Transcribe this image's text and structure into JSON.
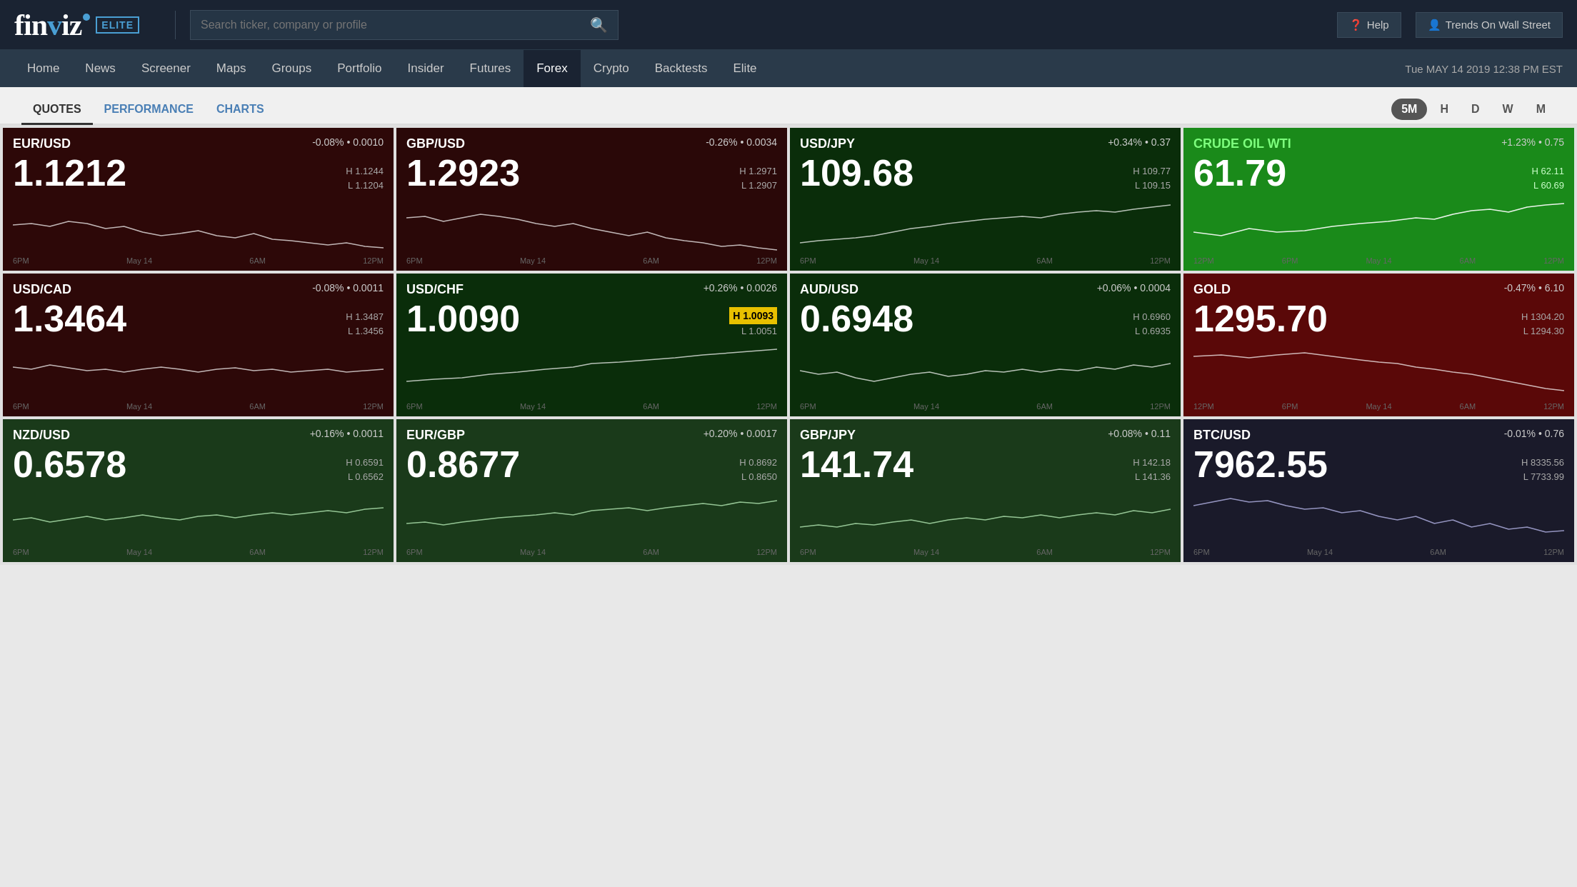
{
  "header": {
    "logo": "finviz",
    "badge": "ELITE",
    "search_placeholder": "Search ticker, company or profile",
    "help_label": "Help",
    "trends_label": "Trends On Wall Street"
  },
  "nav": {
    "items": [
      "Home",
      "News",
      "Screener",
      "Maps",
      "Groups",
      "Portfolio",
      "Insider",
      "Futures",
      "Forex",
      "Crypto",
      "Backtests",
      "Elite"
    ],
    "active": "Forex",
    "datetime": "Tue MAY 14 2019  12:38 PM EST"
  },
  "tabs": {
    "items": [
      "QUOTES",
      "PERFORMANCE",
      "CHARTS"
    ],
    "active": "QUOTES",
    "time_buttons": [
      "5M",
      "H",
      "D",
      "W",
      "M"
    ],
    "active_time": "5M"
  },
  "tiles": [
    {
      "symbol": "EUR/USD",
      "change": "-0.08% • 0.0010",
      "price": "1.1212",
      "high": "H 1.1244",
      "low": "L 1.1204",
      "color": "dark-red",
      "labels": [
        "6PM",
        "",
        "May 14",
        "",
        "6AM",
        "",
        "12PM"
      ]
    },
    {
      "symbol": "GBP/USD",
      "change": "-0.26% • 0.0034",
      "price": "1.2923",
      "high": "H 1.2971",
      "low": "L 1.2907",
      "color": "dark-red",
      "labels": [
        "6PM",
        "",
        "May 14",
        "",
        "6AM",
        "",
        "12PM"
      ]
    },
    {
      "symbol": "USD/JPY",
      "change": "+0.34% • 0.37",
      "price": "109.68",
      "high": "H 109.77",
      "low": "L 109.15",
      "color": "dark-green",
      "labels": [
        "6PM",
        "",
        "May 14",
        "",
        "6AM",
        "",
        "12PM"
      ]
    },
    {
      "symbol": "CRUDE OIL WTI",
      "change": "+1.23% • 0.75",
      "price": "61.79",
      "high": "H 62.11",
      "low": "L 60.69",
      "color": "bright-green",
      "labels": [
        "12PM",
        "",
        "6PM",
        "",
        "May 14",
        "",
        "6AM",
        "",
        "12PM"
      ]
    },
    {
      "symbol": "USD/CAD",
      "change": "-0.08% • 0.0011",
      "price": "1.3464",
      "high": "H 1.3487",
      "low": "L 1.3456",
      "color": "dark-red",
      "labels": [
        "6PM",
        "",
        "May 14",
        "",
        "6AM",
        "",
        "12PM"
      ]
    },
    {
      "symbol": "USD/CHF",
      "change": "+0.26% • 0.0026",
      "price": "1.0090",
      "high_highlighted": "H 1.0093",
      "low": "L 1.0051",
      "color": "dark-green",
      "labels": [
        "6PM",
        "",
        "May 14",
        "",
        "6AM",
        "",
        "12PM"
      ]
    },
    {
      "symbol": "AUD/USD",
      "change": "+0.06% • 0.0004",
      "price": "0.6948",
      "high": "H 0.6960",
      "low": "L 0.6935",
      "color": "dark-green",
      "labels": [
        "6PM",
        "",
        "May 14",
        "",
        "6AM",
        "",
        "12PM"
      ]
    },
    {
      "symbol": "GOLD",
      "change": "-0.47% • 6.10",
      "price": "1295.70",
      "high": "H 1304.20",
      "low": "L 1294.30",
      "color": "red",
      "labels": [
        "12PM",
        "",
        "6PM",
        "",
        "May 14",
        "",
        "6AM",
        "",
        "12PM"
      ]
    },
    {
      "symbol": "NZD/USD",
      "change": "+0.16% • 0.0011",
      "price": "0.6578",
      "high": "H 0.6591",
      "low": "L 0.6562",
      "color": "dark-green-light",
      "labels": [
        "6PM",
        "",
        "May 14",
        "",
        "6AM",
        "",
        "12PM"
      ]
    },
    {
      "symbol": "EUR/GBP",
      "change": "+0.20% • 0.0017",
      "price": "0.8677",
      "high": "H 0.8692",
      "low": "L 0.8650",
      "color": "dark-green-light",
      "labels": [
        "6PM",
        "",
        "May 14",
        "",
        "6AM",
        "",
        "12PM"
      ]
    },
    {
      "symbol": "GBP/JPY",
      "change": "+0.08% • 0.11",
      "price": "141.74",
      "high": "H 142.18",
      "low": "L 141.36",
      "color": "dark-green-light",
      "labels": [
        "6PM",
        "",
        "May 14",
        "",
        "6AM",
        "",
        "12PM"
      ]
    },
    {
      "symbol": "BTC/USD",
      "change": "-0.01% • 0.76",
      "price": "7962.55",
      "high": "H 8335.56",
      "low": "L 7733.99",
      "color": "neutral-dark",
      "labels": [
        "6PM",
        "",
        "May 14",
        "",
        "6AM",
        "",
        "12PM"
      ]
    }
  ]
}
